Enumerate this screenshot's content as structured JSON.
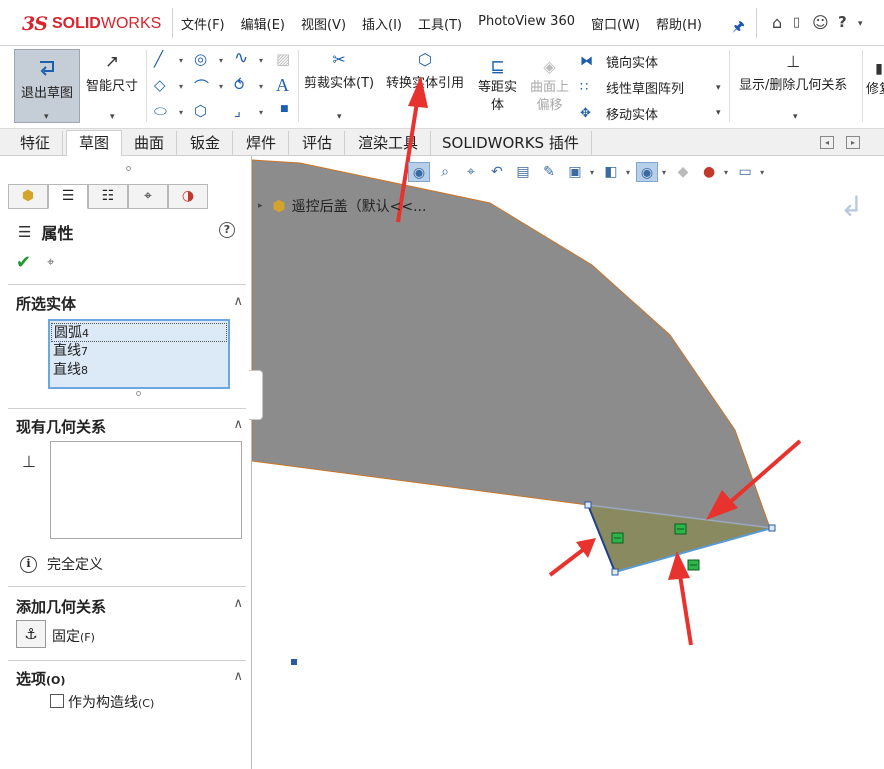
{
  "app": {
    "logo_ds": "3S",
    "logo_solid": "SOLID",
    "logo_works": "WORKS",
    "menu": [
      "文件(F)",
      "编辑(E)",
      "视图(V)",
      "插入(I)",
      "工具(T)",
      "PhotoView 360",
      "窗口(W)",
      "帮助(H)"
    ],
    "right_icons": [
      "home-icon",
      "document-icon",
      "user-icon",
      "help-icon"
    ]
  },
  "ribbon": {
    "exit_sketch": "退出草图",
    "smart_dim": "智能尺寸",
    "trim": "剪裁实体(T)",
    "convert": "转换实体引用",
    "offset_line1": "等距实",
    "offset_line2": "体",
    "surface_offset_line1": "曲面上",
    "surface_offset_line2": "偏移",
    "mirror": "镜向实体",
    "linear_pattern": "线性草图阵列",
    "move": "移动实体",
    "display_relations": "显示/删除几何关系",
    "repair": "修复"
  },
  "tabs": [
    "特征",
    "草图",
    "曲面",
    "钣金",
    "焊件",
    "评估",
    "渲染工具",
    "SOLIDWORKS 插件"
  ],
  "active_tab": "草图",
  "panel": {
    "title": "属性",
    "selected_header": "所选实体",
    "selected_items": [
      {
        "name": "圆弧",
        "num": "4"
      },
      {
        "name": "直线",
        "num": "7"
      },
      {
        "name": "直线",
        "num": "8"
      }
    ],
    "existing_header": "现有几何关系",
    "status": "完全定义",
    "add_header": "添加几何关系",
    "fix_label": "固定",
    "fix_shortcut": "(F)",
    "options_header": "选项",
    "options_shortcut": "(O)",
    "construction": "作为构造线",
    "construction_shortcut": "(C)"
  },
  "graphics": {
    "tree_node": "遥控后盖（默认<<...",
    "colors": {
      "part_fill": "#8c8c8c",
      "part_edge": "#c8762a",
      "selected_fill": "#8a8a60",
      "selected_edge": "#5b9bd5",
      "arrow": "#e8322d",
      "relation_marker": "#2db54a"
    }
  }
}
